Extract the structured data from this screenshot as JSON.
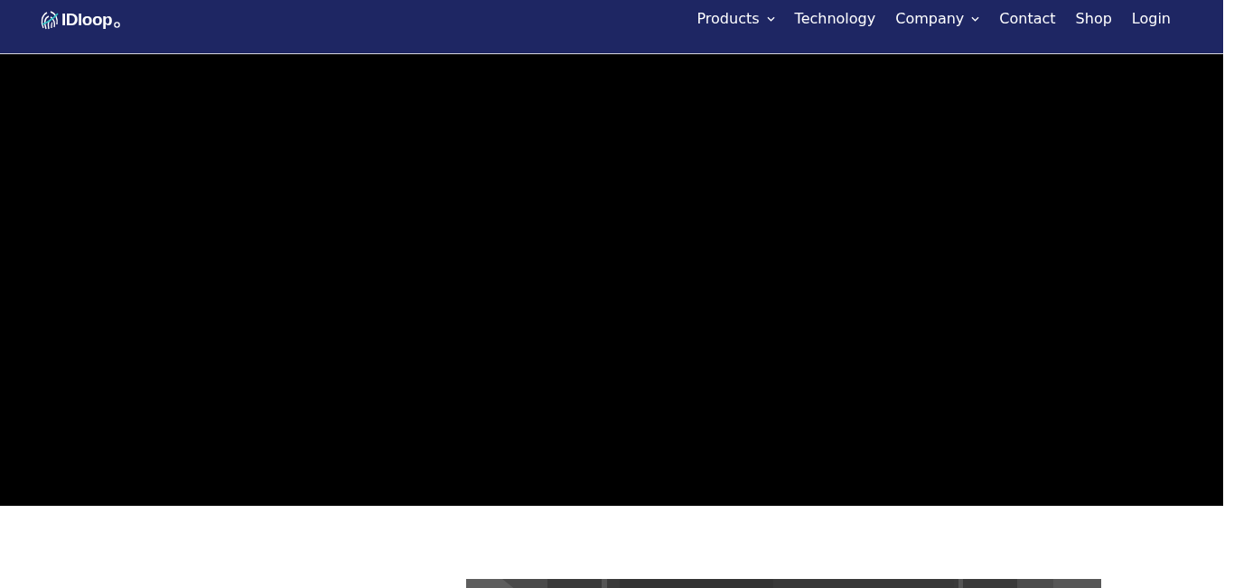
{
  "header": {
    "logo": "IDloop",
    "nav": [
      {
        "label": "Products",
        "has_menu": true
      },
      {
        "label": "Technology",
        "has_menu": false
      },
      {
        "label": "Company",
        "has_menu": true
      },
      {
        "label": "Contact",
        "has_menu": false
      },
      {
        "label": "Shop",
        "has_menu": false
      },
      {
        "label": "Login",
        "has_menu": false
      }
    ]
  },
  "hero": {
    "kind": "video"
  }
}
